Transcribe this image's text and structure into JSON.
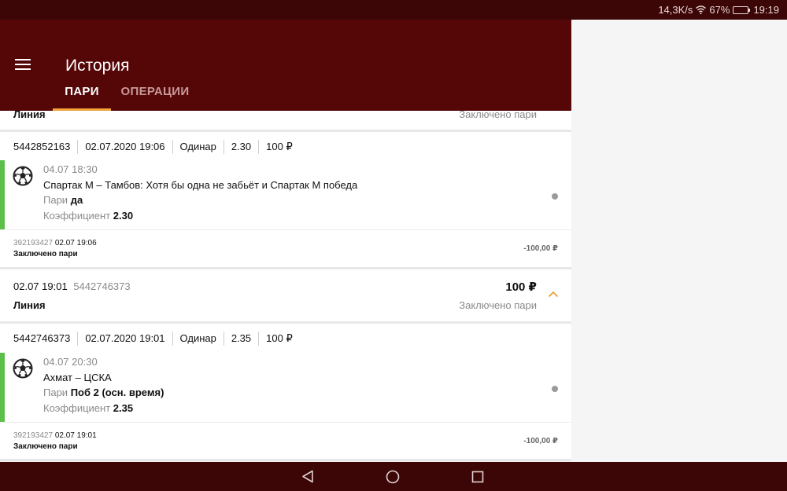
{
  "status": {
    "speed": "14,3K/s",
    "battery": "67%",
    "time": "19:19",
    "battery_level": 0.67
  },
  "app": {
    "title": "История"
  },
  "tabs": [
    {
      "label": "ПАРИ"
    },
    {
      "label": "ОПЕРАЦИИ"
    }
  ],
  "top_partial": {
    "line": "Линия",
    "status": "Заключено пари"
  },
  "bet1": {
    "id": "5442852163",
    "datetime": "02.07.2020 19:06",
    "type": "Одинар",
    "odds": "2.30",
    "amount": "100 ₽",
    "event_time": "04.07 18:30",
    "event": "Спартак М – Тамбов: Хотя бы одна не забьёт и Спартак М победа",
    "bet_label": "Пари",
    "bet_value": "да",
    "coef_label": "Коэффициент",
    "coef_value": "2.30",
    "footer_id": "392193427",
    "footer_time": "02.07 19:06",
    "footer_status": "Заключено пари",
    "footer_amount": "-100,00 ₽"
  },
  "summary2": {
    "time": "02.07 19:01",
    "id": "5442746373",
    "amount": "100 ₽",
    "line": "Линия",
    "status": "Заключено пари"
  },
  "bet2": {
    "id": "5442746373",
    "datetime": "02.07.2020 19:01",
    "type": "Одинар",
    "odds": "2.35",
    "amount": "100 ₽",
    "event_time": "04.07 20:30",
    "event": "Ахмат – ЦСКА",
    "bet_label": "Пари",
    "bet_value": "Поб 2 (осн. время)",
    "coef_label": "Коэффициент",
    "coef_value": "2.35",
    "footer_id": "392193427",
    "footer_time": "02.07 19:01",
    "footer_status": "Заключено пари",
    "footer_amount": "-100,00 ₽"
  }
}
